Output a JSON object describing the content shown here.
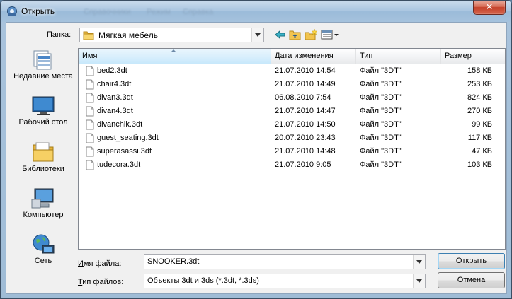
{
  "window": {
    "title": "Открыть",
    "ghost_menu": [
      "Справочники",
      "Режим",
      "Справка"
    ],
    "close_symbol": "✕"
  },
  "topbar": {
    "folder_label": "Папка:",
    "folder_value": "Мягкая мебель",
    "icons": [
      "back-arrow-icon",
      "up-folder-icon",
      "new-folder-icon",
      "view-menu-icon"
    ]
  },
  "places": [
    {
      "label": "Недавние места",
      "icon": "recent-places-icon"
    },
    {
      "label": "Рабочий стол",
      "icon": "desktop-icon"
    },
    {
      "label": "Библиотеки",
      "icon": "libraries-icon"
    },
    {
      "label": "Компьютер",
      "icon": "computer-icon"
    },
    {
      "label": "Сеть",
      "icon": "network-icon"
    }
  ],
  "columns": {
    "name": "Имя",
    "date": "Дата изменения",
    "type": "Тип",
    "size": "Размер"
  },
  "files": [
    {
      "name": "bed2.3dt",
      "date": "21.07.2010 14:54",
      "type": "Файл \"3DT\"",
      "size": "158 КБ"
    },
    {
      "name": "chair4.3dt",
      "date": "21.07.2010 14:49",
      "type": "Файл \"3DT\"",
      "size": "253 КБ"
    },
    {
      "name": "divan3.3dt",
      "date": "06.08.2010 7:54",
      "type": "Файл \"3DT\"",
      "size": "824 КБ"
    },
    {
      "name": "divan4.3dt",
      "date": "21.07.2010 14:47",
      "type": "Файл \"3DT\"",
      "size": "270 КБ"
    },
    {
      "name": "divanchik.3dt",
      "date": "21.07.2010 14:50",
      "type": "Файл \"3DT\"",
      "size": "99 КБ"
    },
    {
      "name": "guest_seating.3dt",
      "date": "20.07.2010 23:43",
      "type": "Файл \"3DT\"",
      "size": "117 КБ"
    },
    {
      "name": "superasassi.3dt",
      "date": "21.07.2010 14:48",
      "type": "Файл \"3DT\"",
      "size": "47 КБ"
    },
    {
      "name": "tudecora.3dt",
      "date": "21.07.2010 9:05",
      "type": "Файл \"3DT\"",
      "size": "103 КБ"
    }
  ],
  "bottom": {
    "filename_label_ul": "И",
    "filename_label_rest": "мя файла:",
    "filename_value": "SNOOKER.3dt",
    "filetype_label_ul": "Т",
    "filetype_label_rest": "ип файлов:",
    "filetype_value": "Объекты 3dt и 3ds (*.3dt, *.3ds)",
    "open_button_ul": "О",
    "open_button_rest": "ткрыть",
    "cancel_button": "Отмена"
  }
}
